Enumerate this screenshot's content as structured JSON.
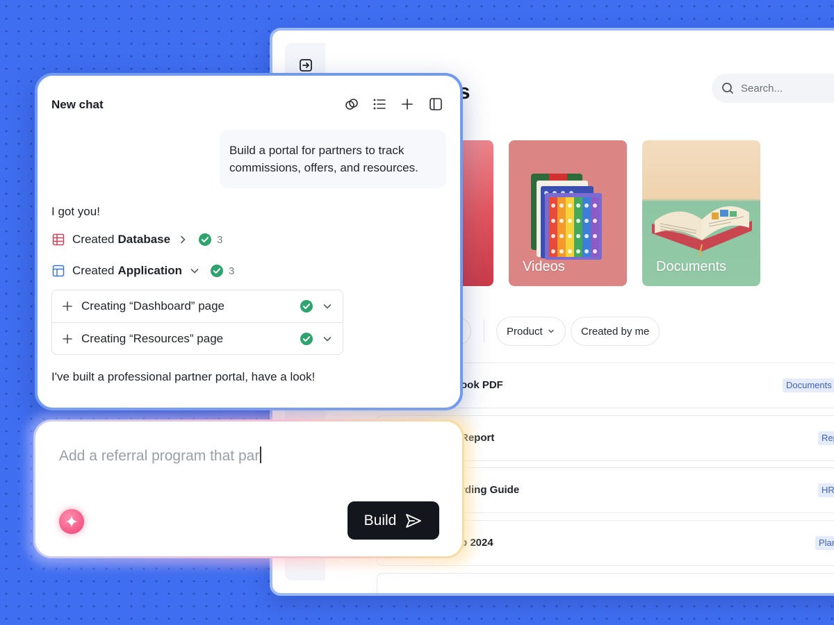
{
  "app": {
    "title_fragment": "es",
    "search_placeholder": "Search...",
    "cards": [
      {
        "label": ""
      },
      {
        "label": "Videos"
      },
      {
        "label": "Documents"
      }
    ],
    "filters": {
      "product": "Product",
      "created_by_me": "Created by me"
    },
    "rows": [
      {
        "name": "ook PDF",
        "tag": "Documents"
      },
      {
        "name": "Report",
        "tag": "Rep"
      },
      {
        "name": "rding Guide",
        "tag": "HR"
      },
      {
        "name": "p 2024",
        "tag": "Plan"
      }
    ]
  },
  "chat": {
    "title": "New chat",
    "user_message": "Build a portal for partners to track commissions, offers, and resources.",
    "reply_intro": "I got you!",
    "created_database": {
      "prefix": "Created",
      "name": "Database",
      "count": "3"
    },
    "created_application": {
      "prefix": "Created",
      "name": "Application",
      "count": "3"
    },
    "tasks": [
      {
        "label": "Creating “Dashboard” page"
      },
      {
        "label": "Creating “Resources” page"
      }
    ],
    "summary": "I've built a professional partner portal, have a look!"
  },
  "composer": {
    "draft": "Add a referral program that par",
    "build_label": "Build"
  },
  "colors": {
    "background": "#3f6ef0",
    "chat_border": "#6f9af2",
    "success": "#2ea36e",
    "button": "#13161c",
    "sparkle": "#ef3f72",
    "tag_bg": "#e4ebfb",
    "tag_text": "#4062b8"
  },
  "icons": [
    "expand-panel-icon",
    "search-icon",
    "link-icon",
    "list-icon",
    "plus-icon",
    "sidebar-toggle-icon",
    "table-icon",
    "layout-icon",
    "chevron-right-icon",
    "chevron-down-icon",
    "check-circle-icon",
    "sparkle-icon",
    "send-icon"
  ]
}
